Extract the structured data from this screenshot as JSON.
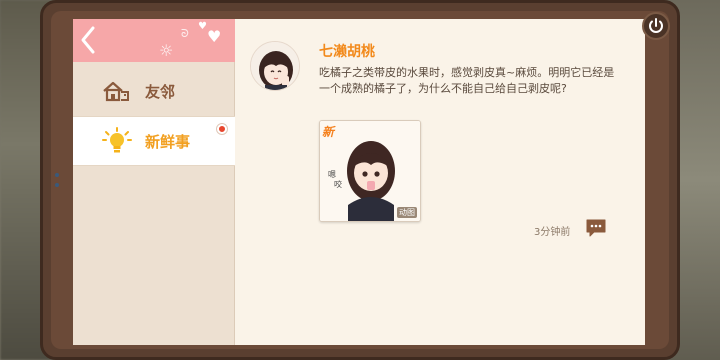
{
  "sidebar": {
    "items": [
      {
        "label": "友邻",
        "icon": "house-icon"
      },
      {
        "label": "新鲜事",
        "icon": "lightbulb-icon",
        "selected": true,
        "unread": true
      }
    ]
  },
  "post": {
    "username": "七濑胡桃",
    "text": "吃橘子之类带皮的水果时，感觉剥皮真~麻烦。明明它已经是一个成熟的橘子了，为什么不能自己给自己剥皮呢?",
    "image_new_tag": "新",
    "image_badge": "动图",
    "timestamp": "3分钟前"
  },
  "colors": {
    "header_pink": "#f6a7a8",
    "username_orange": "#f28a1c",
    "selected_label": "#f2a021",
    "nav_label": "#8a5a3c",
    "screen_bg": "#faf3e8",
    "sidebar_bg": "#ede0d1",
    "frame_brown": "#5a3f30"
  }
}
